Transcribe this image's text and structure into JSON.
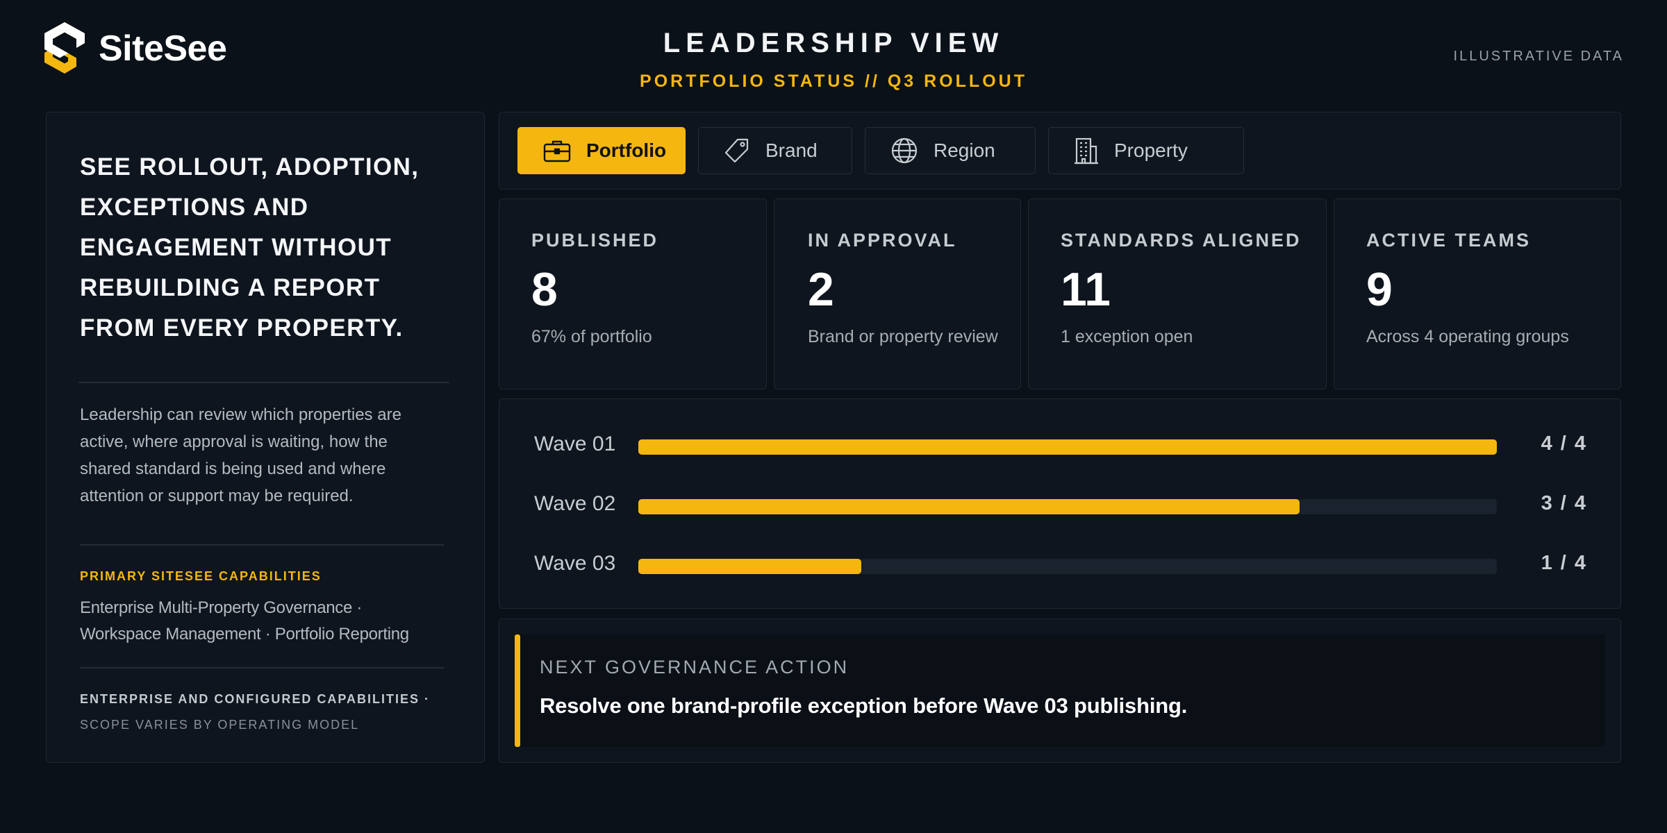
{
  "brand": {
    "name": "SiteSee"
  },
  "header": {
    "title": "LEADERSHIP VIEW",
    "subtitle": "PORTFOLIO STATUS // Q3 ROLLOUT",
    "note": "ILLUSTRATIVE DATA"
  },
  "left_panel": {
    "headline": "SEE ROLLOUT, ADOPTION, EXCEPTIONS AND ENGAGEMENT WITHOUT REBUILDING A REPORT FROM EVERY PROPERTY.",
    "body": "Leadership can review which properties are active, where approval is waiting, how the shared standard is being used and where attention or support may be required.",
    "capabilities_label": "PRIMARY SITESEE CAPABILITIES",
    "capabilities": "Enterprise Multi-Property Governance · Workspace Management · Portfolio Reporting",
    "footnote_line1": "ENTERPRISE AND CONFIGURED CAPABILITIES ·",
    "footnote_line2": "SCOPE VARIES BY OPERATING MODEL"
  },
  "tabs": [
    {
      "label": "Portfolio",
      "icon": "briefcase-icon",
      "active": true
    },
    {
      "label": "Brand",
      "icon": "tag-icon",
      "active": false
    },
    {
      "label": "Region",
      "icon": "globe-icon",
      "active": false
    },
    {
      "label": "Property",
      "icon": "building-icon",
      "active": false
    }
  ],
  "stats": [
    {
      "label": "PUBLISHED",
      "value": "8",
      "note": "67% of portfolio"
    },
    {
      "label": "IN APPROVAL",
      "value": "2",
      "note": "Brand or property review"
    },
    {
      "label": "STANDARDS ALIGNED",
      "value": "11",
      "note": "1 exception open"
    },
    {
      "label": "ACTIVE TEAMS",
      "value": "9",
      "note": "Across 4 operating groups"
    }
  ],
  "waves": [
    {
      "label": "Wave 01",
      "done": 4,
      "total": 4,
      "count": "4 / 4",
      "progress": 1.0
    },
    {
      "label": "Wave 02",
      "done": 3,
      "total": 4,
      "count": "3 / 4",
      "progress": 0.77
    },
    {
      "label": "Wave 03",
      "done": 1,
      "total": 4,
      "count": "1 / 4",
      "progress": 0.26
    }
  ],
  "next_action": {
    "label": "NEXT GOVERNANCE ACTION",
    "text": "Resolve one brand-profile exception before Wave 03 publishing."
  },
  "colors": {
    "accent": "#f5b70f",
    "background": "#0b1119",
    "panel": "#0e151e",
    "track": "#1a222d"
  }
}
